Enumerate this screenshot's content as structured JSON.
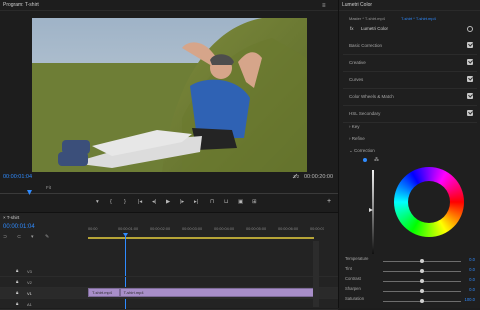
{
  "program": {
    "title": "Program: T-shirt",
    "timecode_current": "00:00:01:04",
    "fit_label": "Fit",
    "fraction": "1/2",
    "timecode_duration": "00:00:20:00"
  },
  "timeline": {
    "title": "T-shirt",
    "timecode": "00:00:01:04",
    "ruler": [
      "00:00",
      "00:00:01:00",
      "00:00:02:00",
      "00:00:03:00",
      "00:00:04:00",
      "00:00:05:00",
      "00:00:06:00",
      "00:00:07:00"
    ],
    "tracks": [
      {
        "label": "V3"
      },
      {
        "label": "V2"
      },
      {
        "label": "V1"
      },
      {
        "label": "A1"
      }
    ],
    "clips": [
      {
        "label": "T-shirt.mp4",
        "from": 0,
        "to": 0.14
      },
      {
        "label": "T-shirt.mp4",
        "from": 0.14,
        "to": 1
      }
    ]
  },
  "lumetri": {
    "title": "Lumetri Color",
    "master": "Master * T-shirt.mp4",
    "sequence": "T-shirt * T-shirt.mp4",
    "fx_label": "fx",
    "effect_name": "Lumetri Color",
    "sections": [
      "Basic Correction",
      "Creative",
      "Curves",
      "Color Wheels & Match",
      "HSL Secondary"
    ],
    "subsections": [
      "Key",
      "Refine",
      "Correction"
    ],
    "sliders": [
      {
        "label": "Temperature",
        "value": "0.0",
        "pos": 0.5
      },
      {
        "label": "Tint",
        "value": "0.0",
        "pos": 0.5
      },
      {
        "label": "Contrast",
        "value": "0.0",
        "pos": 0.5
      },
      {
        "label": "Sharpen",
        "value": "0.0",
        "pos": 0.5
      },
      {
        "label": "Saturation",
        "value": "100.0",
        "pos": 0.5
      }
    ]
  },
  "icons": [
    "wrench-icon",
    "marker-icon",
    "play-icon",
    "step-back-icon",
    "step-forward-icon",
    "camera-icon",
    "plus-icon",
    "menu-icon"
  ],
  "colors": {
    "accent": "#2f8bff",
    "clip": "#a88ec9"
  }
}
